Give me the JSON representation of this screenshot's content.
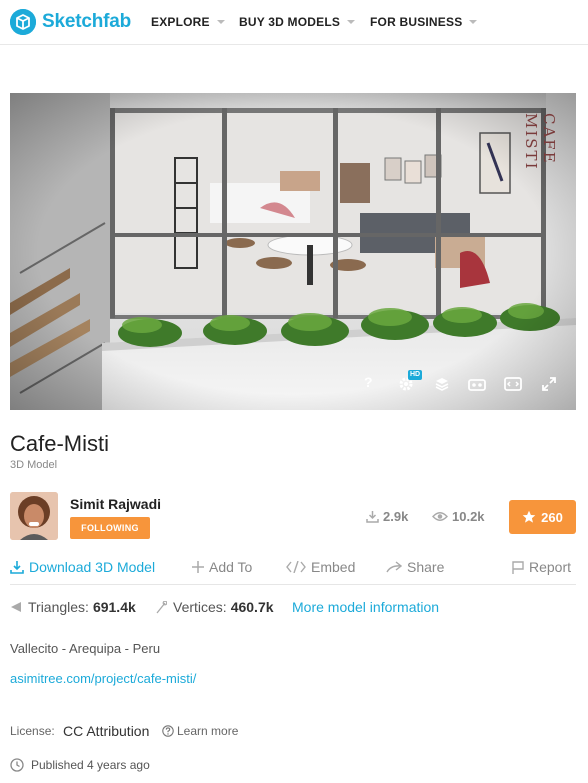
{
  "brand": {
    "name": "Sketchfab",
    "color": "#1caad9"
  },
  "nav": {
    "items": [
      {
        "label": "EXPLORE"
      },
      {
        "label": "BUY 3D MODELS"
      },
      {
        "label": "FOR BUSINESS"
      }
    ]
  },
  "viewer": {
    "watermark": "CAFE MISTI",
    "controls": [
      {
        "icon": "help-icon",
        "label": "?"
      },
      {
        "icon": "settings-icon",
        "badge": "HD"
      },
      {
        "icon": "layers-icon"
      },
      {
        "icon": "vr-icon"
      },
      {
        "icon": "theater-mode-icon"
      },
      {
        "icon": "fullscreen-icon"
      }
    ]
  },
  "model": {
    "title": "Cafe-Misti",
    "subtitle": "3D Model",
    "description": "Vallecito - Arequipa - Peru",
    "url": "asimitree.com/project/cafe-misti/"
  },
  "author": {
    "name": "Simit Rajwadi",
    "follow_label": "FOLLOWING"
  },
  "stats": {
    "downloads": "2.9k",
    "views": "10.2k",
    "likes": "260"
  },
  "actions": {
    "download": "Download 3D Model",
    "add_to": "Add To",
    "embed": "Embed",
    "share": "Share",
    "report": "Report"
  },
  "info": {
    "triangles_label": "Triangles:",
    "triangles": "691.4k",
    "vertices_label": "Vertices:",
    "vertices": "460.7k",
    "more_label": "More model information"
  },
  "license": {
    "label": "License:",
    "name": "CC Attribution",
    "learn_more": "Learn more"
  },
  "published": "Published 4 years ago",
  "colors": {
    "accent_blue": "#1caad9",
    "accent_orange": "#f7953b"
  }
}
